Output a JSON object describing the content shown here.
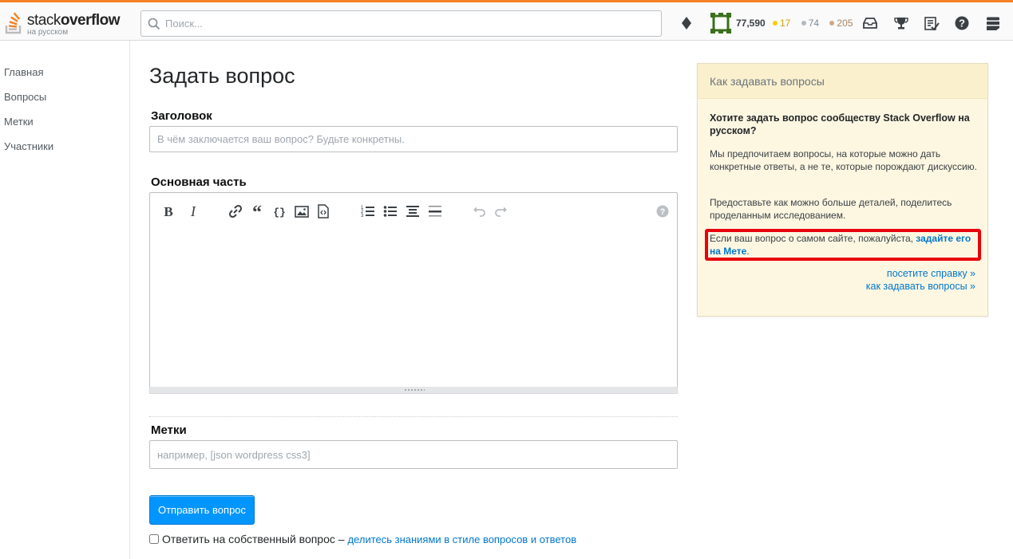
{
  "header": {
    "logo_word_light": "stack",
    "logo_word_bold": "overflow",
    "logo_sub": "на русском",
    "search_placeholder": "Поиск...",
    "reputation": "77,590",
    "badges": {
      "gold": "17",
      "silver": "74",
      "bronze": "205"
    },
    "icons": [
      "diamond-icon",
      "avatar",
      "inbox-icon",
      "achievements-icon",
      "review-icon",
      "help-icon",
      "site-switcher-icon"
    ],
    "accent_color": "#f48024"
  },
  "nav": {
    "items": [
      {
        "label": "Главная"
      },
      {
        "label": "Вопросы"
      },
      {
        "label": "Метки"
      },
      {
        "label": "Участники"
      }
    ]
  },
  "main": {
    "title": "Задать вопрос",
    "title_label": "Заголовок",
    "title_placeholder": "В чём заключается ваш вопрос? Будьте конкретны.",
    "body_label": "Основная часть",
    "toolbar": [
      "bold-icon",
      "italic-icon",
      "link-icon",
      "quote-icon",
      "code-icon",
      "image-icon",
      "snippet-icon",
      "ordered-list-icon",
      "bulleted-list-icon",
      "heading-icon",
      "horizontal-rule-icon",
      "undo-icon",
      "redo-icon",
      "help-icon"
    ],
    "tags_label": "Метки",
    "tags_placeholder": "например, [json wordpress css3]",
    "submit_label": "Отправить вопрос",
    "answer_own_label": "Ответить на собственный вопрос",
    "answer_own_dash": " – ",
    "answer_own_link": "делитесь знаниями в стиле вопросов и ответов",
    "button_color": "#0095ff"
  },
  "sidebar": {
    "title": "Как задавать вопросы",
    "question": "Хотите задать вопрос сообществу Stack Overflow на русском?",
    "p1": "Мы предпочитаем вопросы, на которые можно дать конкретные ответы, а не те, которые порождают дискуссию.",
    "p2": "Предоставьте как можно больше деталей, поделитесь проделанным исследованием.",
    "meta_text": "Если ваш вопрос о самом сайте, пожалуйста, ",
    "meta_link": "задайте его на Мете",
    "meta_end": ".",
    "link_help": "посетите справку »",
    "link_how": "как задавать вопросы »",
    "highlight_color": "#e8000b"
  }
}
